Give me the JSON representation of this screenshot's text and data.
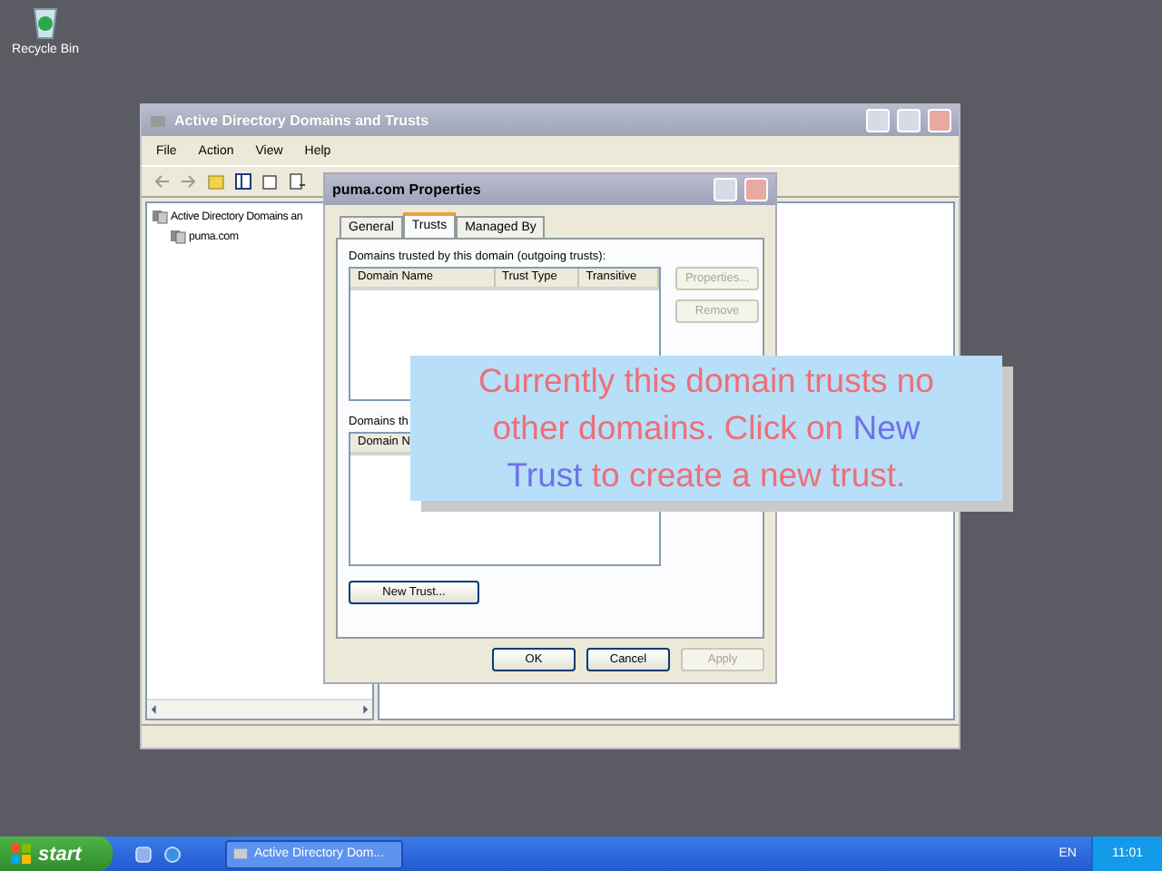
{
  "desktop": {
    "icons": [
      {
        "label": "Recycle Bin"
      }
    ]
  },
  "main_window": {
    "title": "Active Directory Domains and Trusts",
    "menu": [
      "File",
      "Action",
      "View",
      "Help"
    ],
    "tree": [
      {
        "label": "Active Directory Domains an",
        "children": [
          {
            "label": "puma.com"
          }
        ]
      }
    ]
  },
  "dialog": {
    "title": "puma.com Properties",
    "tabs": [
      {
        "label": "General",
        "selected": false
      },
      {
        "label": "Trusts",
        "selected": true
      },
      {
        "label": "Managed By",
        "selected": false
      }
    ],
    "outgoing": {
      "label": "Domains trusted by this domain (outgoing trusts):",
      "columns": [
        "Domain Name",
        "Trust Type",
        "Transitive"
      ]
    },
    "side_buttons": [
      {
        "label": "Properties...",
        "disabled": true
      },
      {
        "label": "Remove",
        "disabled": true
      }
    ],
    "incoming": {
      "label": "Domains th",
      "columns": [
        "Domain N"
      ]
    },
    "new_trust_button": "New Trust...",
    "buttons": [
      {
        "label": "OK",
        "disabled": false
      },
      {
        "label": "Cancel",
        "disabled": false
      },
      {
        "label": "Apply",
        "disabled": true
      }
    ]
  },
  "callout": {
    "lines": [
      [
        {
          "text": "Currently this domain trusts no",
          "highlight": false
        }
      ],
      [
        {
          "text": "other domains. Click on ",
          "highlight": false
        },
        {
          "text": "New",
          "highlight": true
        }
      ],
      [
        {
          "text": "Trust",
          "highlight": true
        },
        {
          "text": " to create a new trust.",
          "highlight": false
        }
      ]
    ]
  },
  "taskbar": {
    "start": "start",
    "tasks": [
      {
        "label": "Active Directory Dom...",
        "selected": false
      }
    ],
    "language": "EN",
    "clock": "11:01"
  }
}
